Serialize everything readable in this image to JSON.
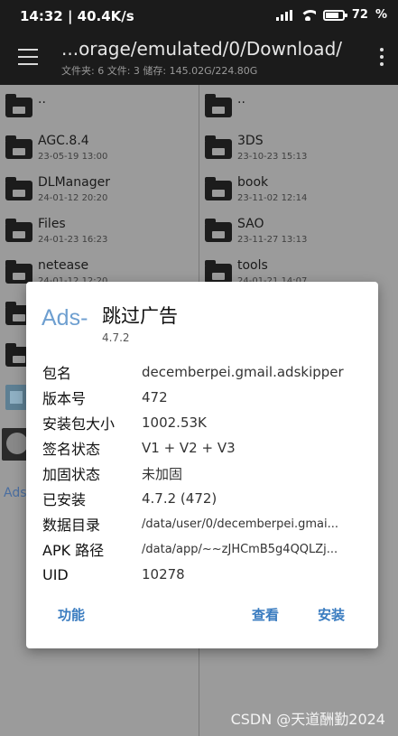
{
  "status": {
    "time_speed": "14:32 | 40.4K/s",
    "battery": "72"
  },
  "appbar": {
    "path": "...orage/emulated/0/Download/",
    "summary": "文件夹: 6  文件: 3  储存: 145.02G/224.80G"
  },
  "left_pane": {
    "items": [
      {
        "name": "..",
        "date": ""
      },
      {
        "name": "AGC.8.4",
        "date": "23-05-19 13:00"
      },
      {
        "name": "DLManager",
        "date": "24-01-12 20:20"
      },
      {
        "name": "Files",
        "date": "24-01-23 16:23"
      },
      {
        "name": "netease",
        "date": "24-01-12 12:20"
      }
    ],
    "partial_text": "Ads"
  },
  "right_pane": {
    "items": [
      {
        "name": "..",
        "date": ""
      },
      {
        "name": "3DS",
        "date": "23-10-23 15:13"
      },
      {
        "name": "book",
        "date": "23-11-02 12:14"
      },
      {
        "name": "SAO",
        "date": "23-11-27 13:13"
      },
      {
        "name": "tools",
        "date": "24-01-21 14:07"
      }
    ]
  },
  "dialog": {
    "logo": "Ads-",
    "title": "跳过广告",
    "version": "4.7.2",
    "info": [
      {
        "label": "包名",
        "value": "decemberpei.gmail.adskipper"
      },
      {
        "label": "版本号",
        "value": "472"
      },
      {
        "label": "安装包大小",
        "value": "1002.53K"
      },
      {
        "label": "签名状态",
        "value": "V1 + V2 + V3"
      },
      {
        "label": "加固状态",
        "value": "未加固"
      },
      {
        "label": "已安装",
        "value": "4.7.2 (472)"
      },
      {
        "label": "数据目录",
        "value": "/data/user/0/decemberpei.gmai..."
      },
      {
        "label": "APK 路径",
        "value": "/data/app/~~zJHCmB5g4QQLZj..."
      },
      {
        "label": "UID",
        "value": "10278"
      }
    ],
    "buttons": {
      "func": "功能",
      "view": "查看",
      "install": "安装"
    }
  },
  "watermark": "CSDN @天道酬勤2024"
}
